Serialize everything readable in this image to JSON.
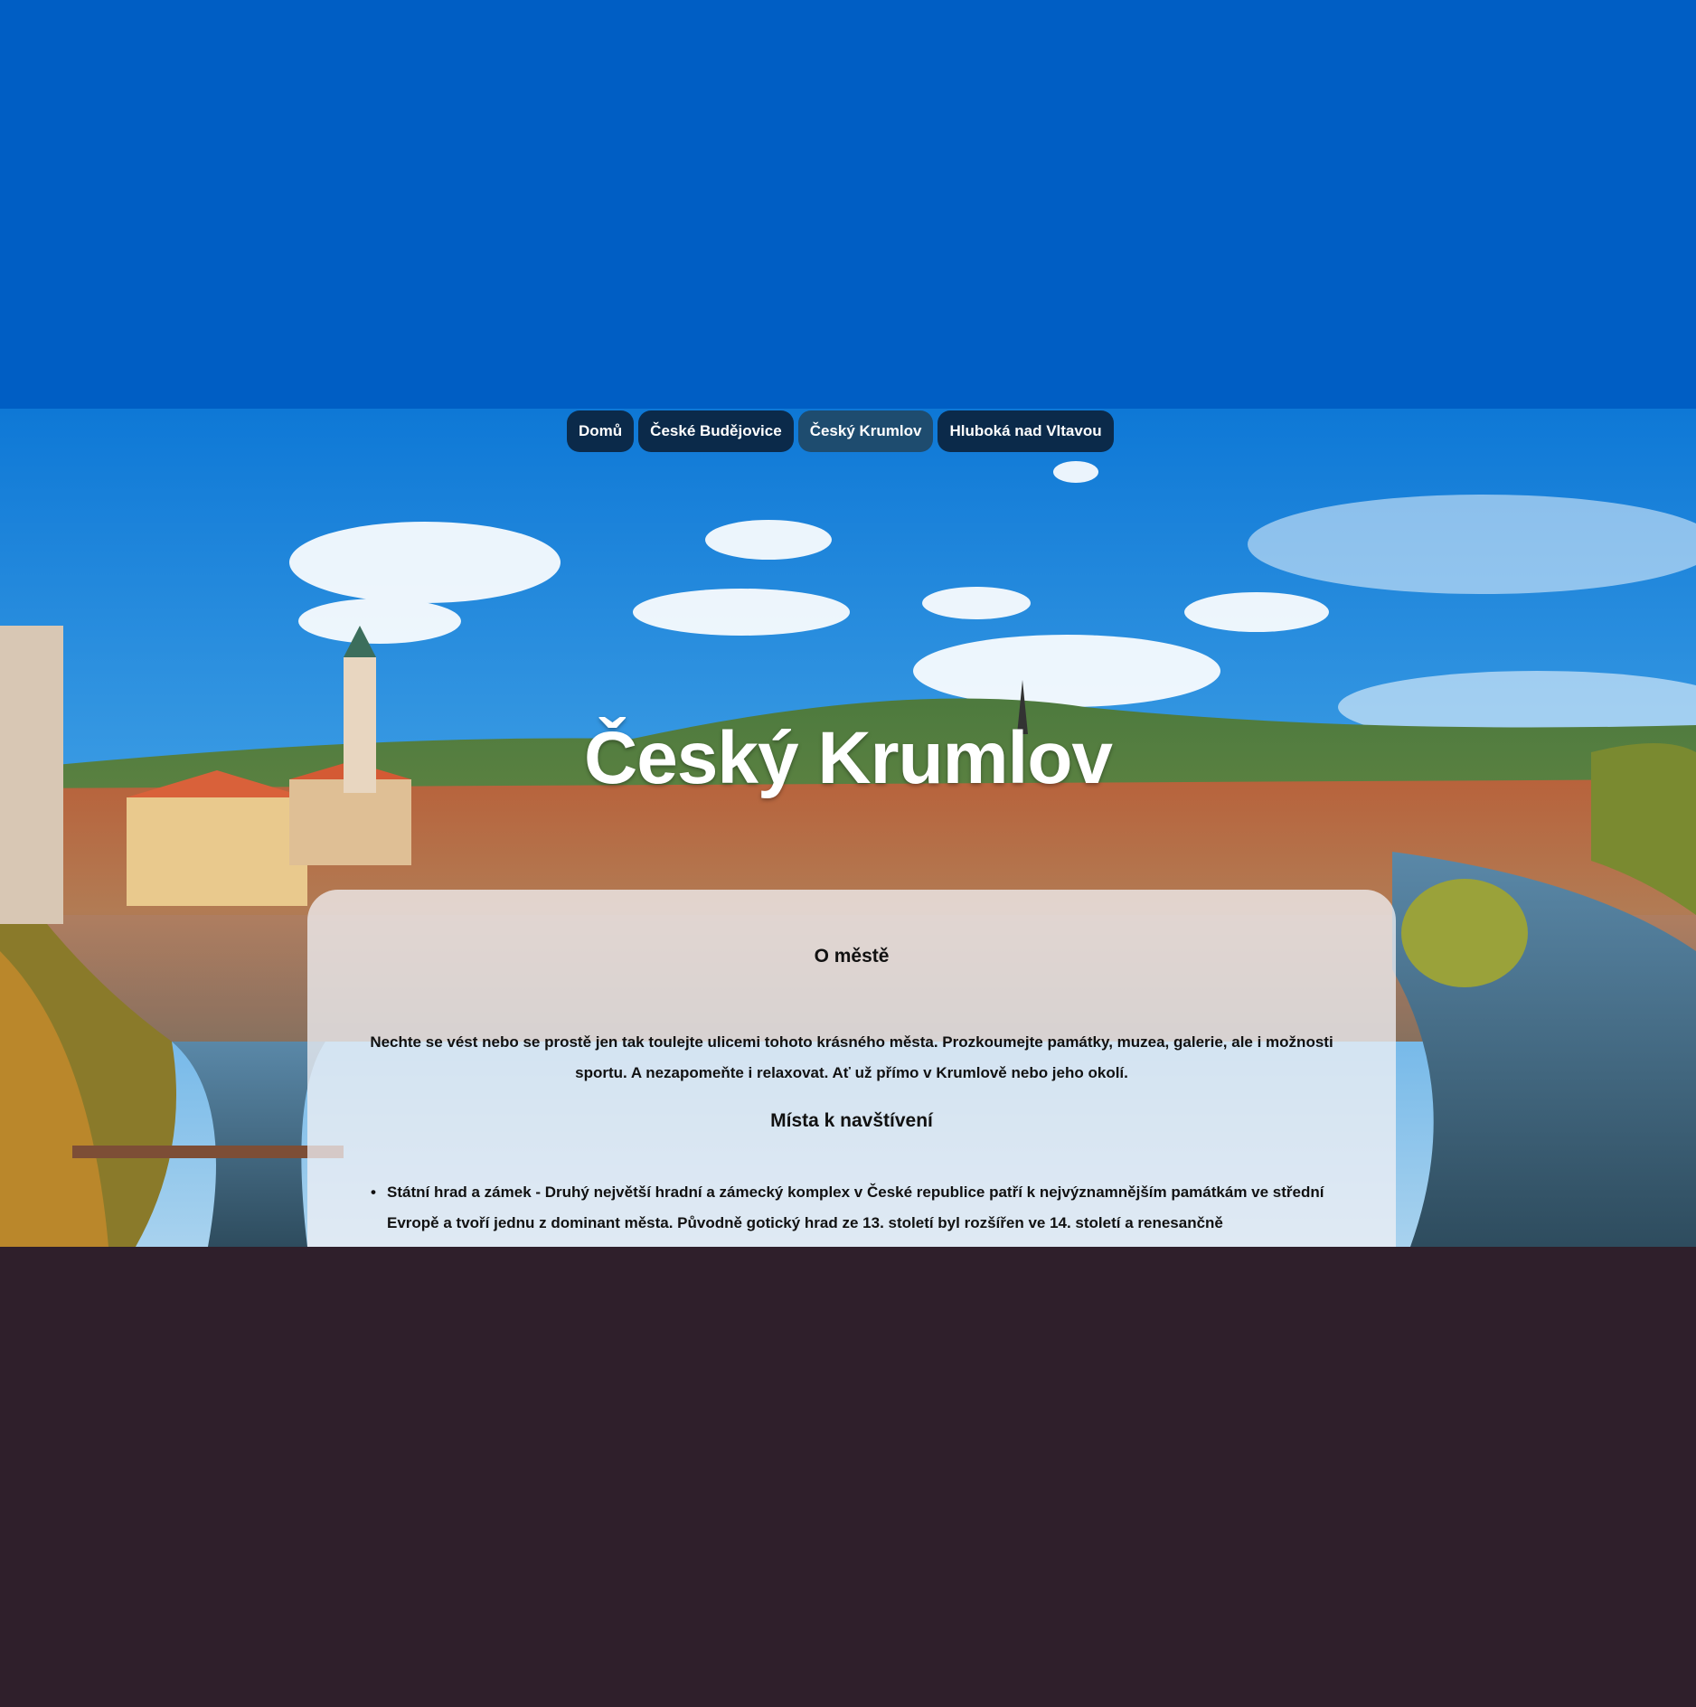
{
  "colors": {
    "top_band": "#005ec4",
    "bottom_band": "#2f1f2b",
    "nav_bg": "#0b2a4a",
    "nav_active_bg": "#1e4c6f",
    "box_bg": "rgba(240,240,245,0.76)"
  },
  "nav": {
    "items": [
      {
        "label": "Domů"
      },
      {
        "label": "České Budějovice"
      },
      {
        "label": "Český Krumlov",
        "active": true
      },
      {
        "label": "Hluboká nad Vltavou"
      }
    ]
  },
  "hero": {
    "title": "Český Krumlov"
  },
  "content": {
    "about_heading": "O městě",
    "about_text": "Nechte se vést nebo se prostě jen tak toulejte ulicemi tohoto krásného města. Prozkoumejte památky, muzea, galerie, ale i možnosti sportu. A nezapomeňte i relaxovat. Ať už přímo v Krumlově nebo jeho okolí.",
    "places_heading": "Místa k navštívení",
    "places": [
      {
        "bullet": "•",
        "text": "Státní hrad a zámek - Druhý největší hradní a zámecký komplex v České republice patří k nejvýznamnějším památkám ve střední Evropě a tvoří jednu z dominant města. Původně gotický hrad ze 13. století byl rozšířen ve 14. století a renesančně"
      }
    ]
  }
}
